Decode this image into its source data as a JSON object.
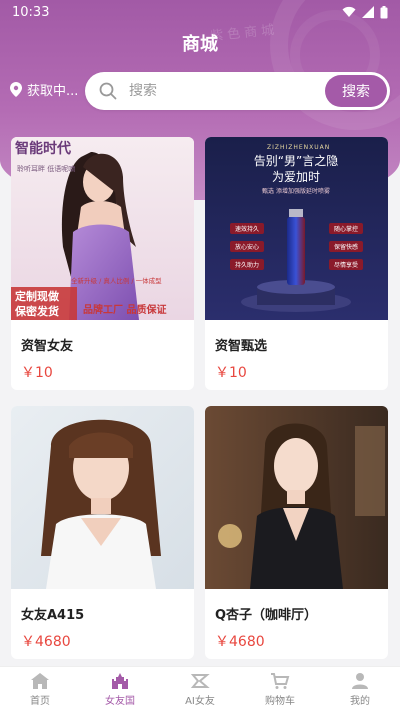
{
  "status": {
    "time": "10:33"
  },
  "header": {
    "title": "商城",
    "location": "获取中...",
    "watermark": "紫色商城"
  },
  "search": {
    "placeholder": "搜索",
    "button": "搜索"
  },
  "products": [
    {
      "name": "资智女友",
      "price": "￥10",
      "banner": {
        "line1": "智能时代",
        "line2": "定制现做",
        "line3": "保密发货",
        "line4": "品牌工厂 品质保证",
        "side": "聆听耳畔 低语呢喃",
        "tag": "全新升级 / 真人比例 / 一体成型"
      }
    },
    {
      "name": "资智甄选",
      "price": "￥10",
      "banner": {
        "brand": "ZIZHIZHENXUAN",
        "headline": "告别“男”言之隐",
        "subline": "为爱加时",
        "sub": "甄选 添增加强版延时喷雾",
        "tags": [
          "速效持久",
          "随心掌控",
          "放心安心",
          "保留快感",
          "持久助力",
          "尽情享受"
        ]
      }
    },
    {
      "name": "女友A415",
      "price": "￥4680"
    },
    {
      "name": "Q杏子（咖啡厅）",
      "price": "￥4680"
    }
  ],
  "nav": [
    {
      "label": "首页",
      "active": false
    },
    {
      "label": "女友国",
      "active": true
    },
    {
      "label": "AI女友",
      "active": false
    },
    {
      "label": "购物车",
      "active": false
    },
    {
      "label": "我的",
      "active": false
    }
  ],
  "colors": {
    "brand": "#a45aa8",
    "price": "#e8473f"
  }
}
